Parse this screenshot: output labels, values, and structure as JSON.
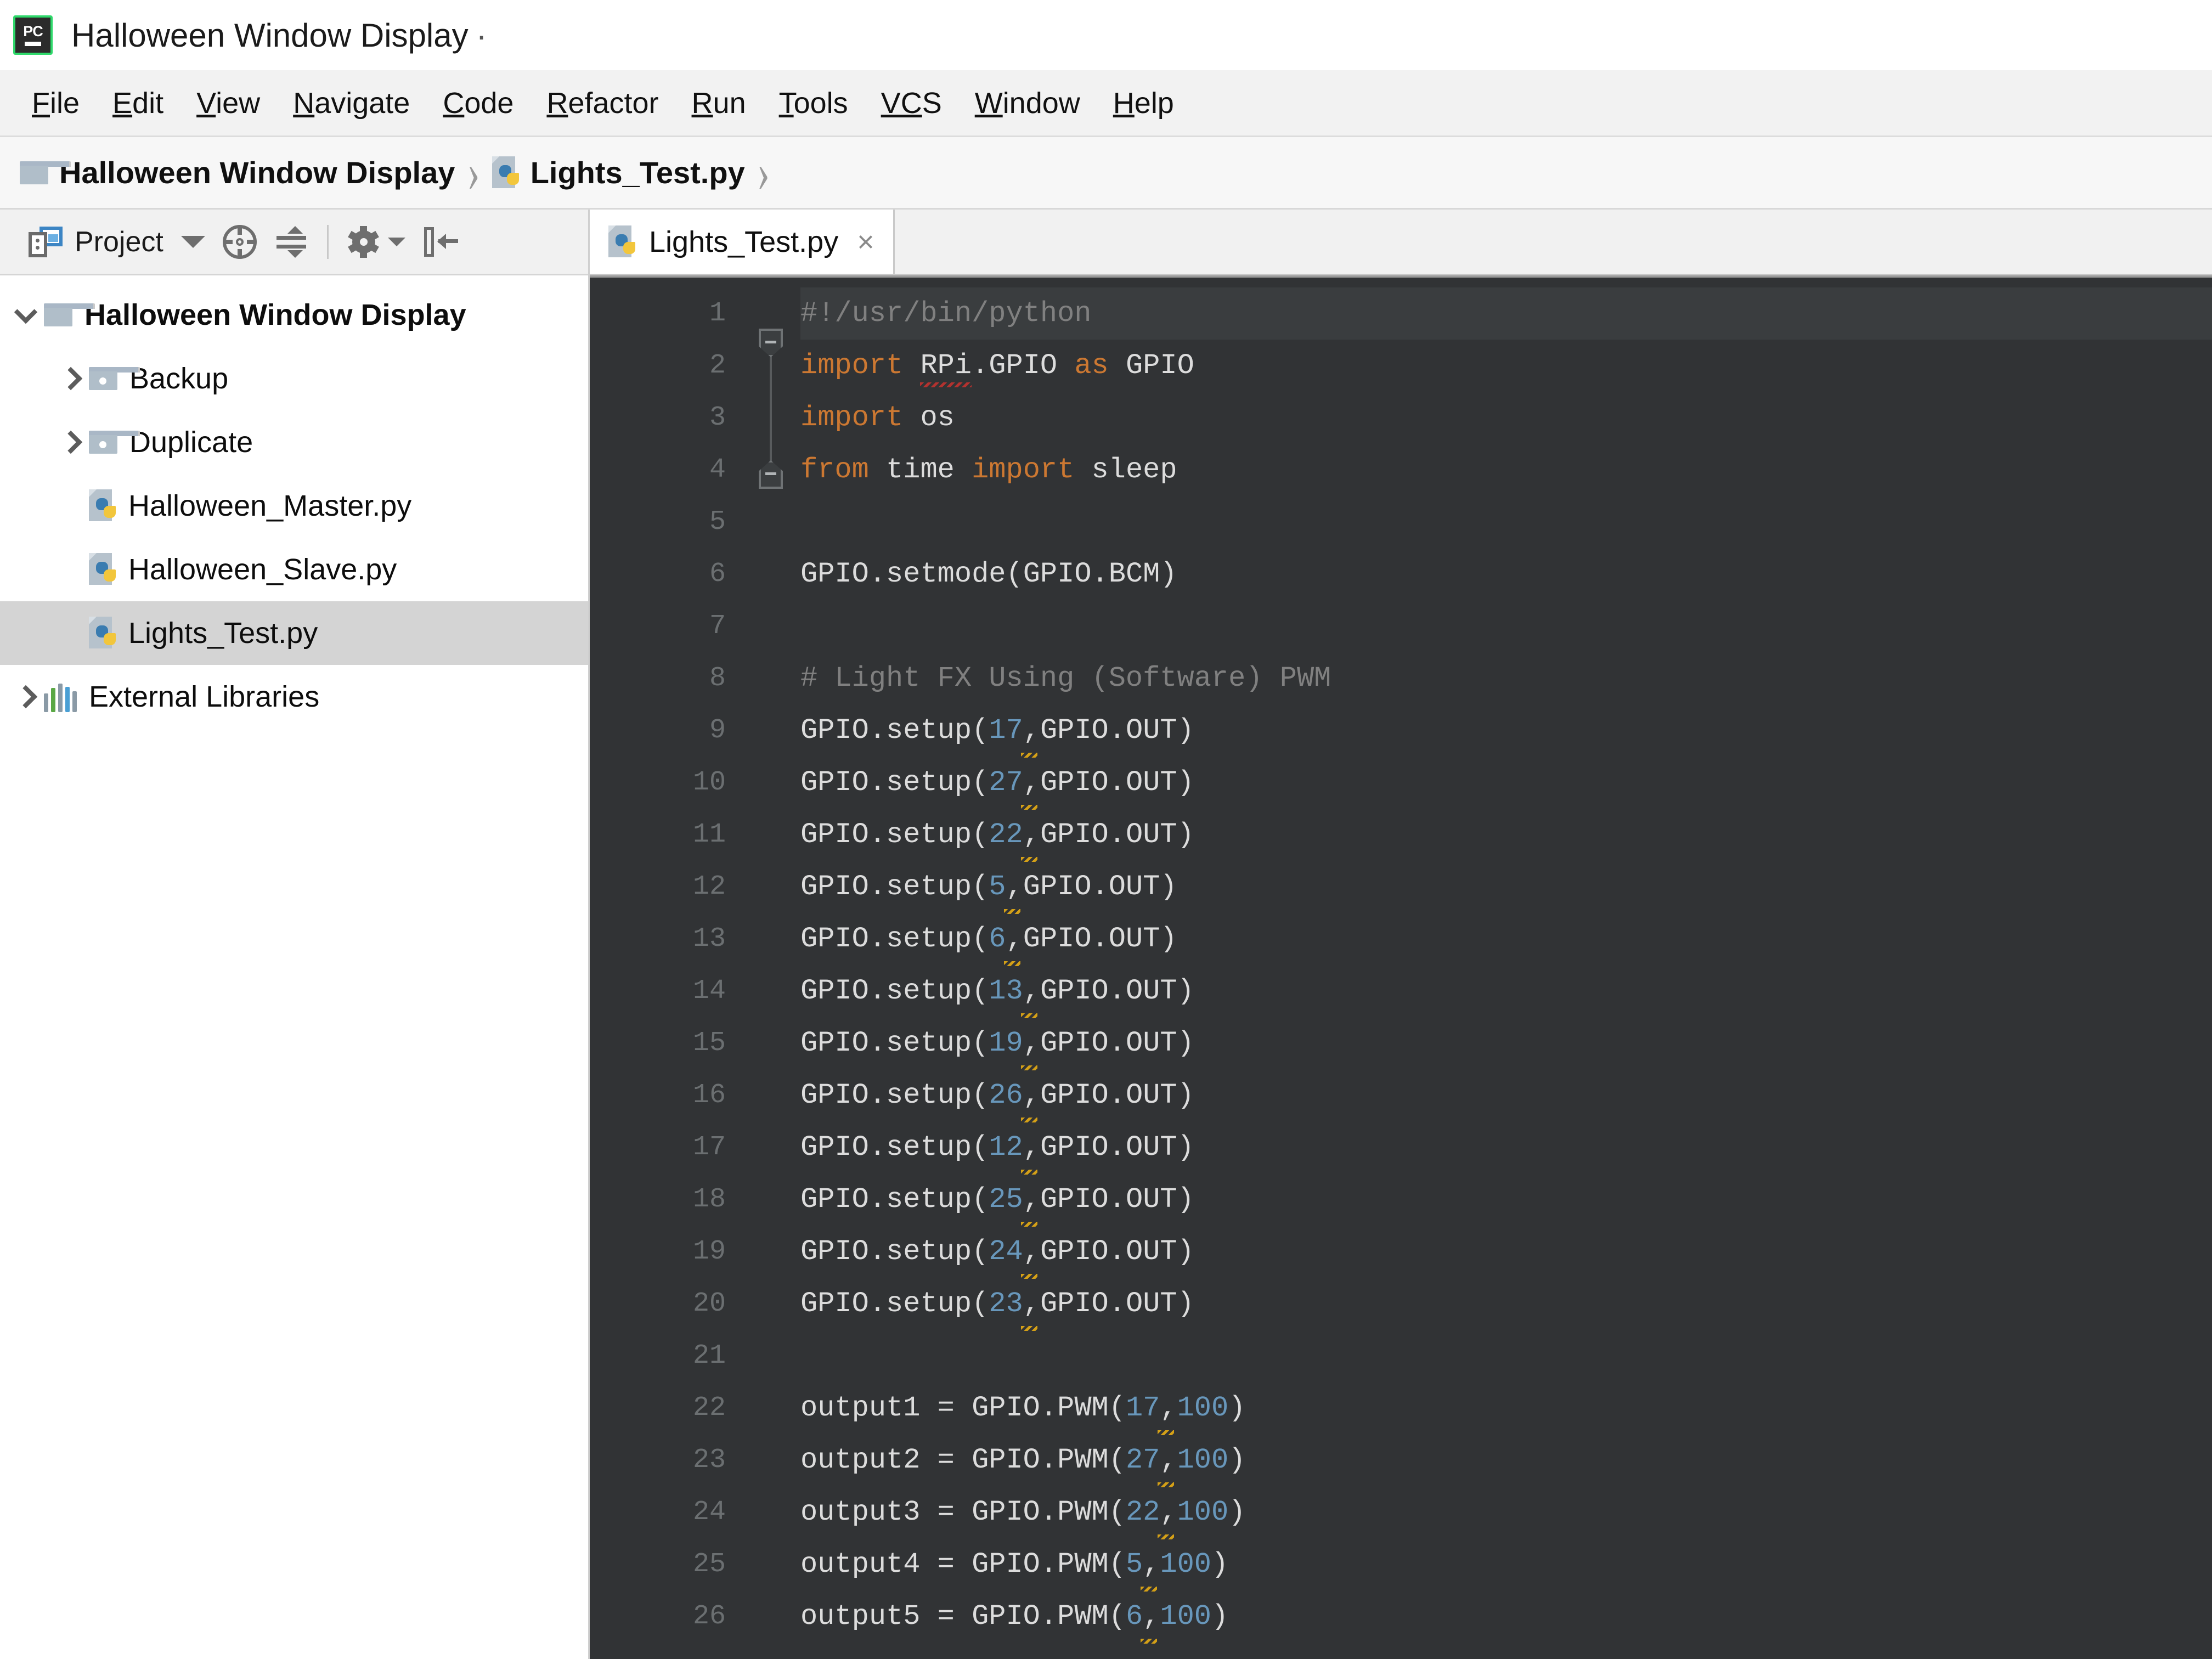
{
  "window": {
    "logo_text": "PC",
    "title": "Halloween Window Display",
    "title_suffix": "·"
  },
  "menubar": {
    "items": [
      {
        "label": "File",
        "mnemonic": "F",
        "rest": "ile"
      },
      {
        "label": "Edit",
        "mnemonic": "E",
        "rest": "dit"
      },
      {
        "label": "View",
        "mnemonic": "V",
        "rest": "iew"
      },
      {
        "label": "Navigate",
        "mnemonic": "N",
        "rest": "avigate"
      },
      {
        "label": "Code",
        "mnemonic": "C",
        "rest": "ode"
      },
      {
        "label": "Refactor",
        "mnemonic": "R",
        "rest": "efactor"
      },
      {
        "label": "Run",
        "mnemonic": "R",
        "rest": "un"
      },
      {
        "label": "Tools",
        "mnemonic": "T",
        "rest": "ools"
      },
      {
        "label": "VCS",
        "mnemonic": "VC",
        "rest": "S"
      },
      {
        "label": "Window",
        "mnemonic": "W",
        "rest": "indow"
      },
      {
        "label": "Help",
        "mnemonic": "H",
        "rest": "elp"
      }
    ]
  },
  "breadcrumb": {
    "project": "Halloween Window Display",
    "file": "Lights_Test.py",
    "separator": "›"
  },
  "panel_toolbar": {
    "title": "Project",
    "icons": [
      "project-icon",
      "chevron-down-icon",
      "locate-icon",
      "collapse-all-icon",
      "gear-icon",
      "hide-panel-icon"
    ]
  },
  "project_tree": {
    "items": [
      {
        "label": "Halloween Window Display",
        "type": "folder-root",
        "expanded": true,
        "depth": 0,
        "bold": true,
        "selected": false
      },
      {
        "label": "Backup",
        "type": "folder",
        "expanded": false,
        "depth": 1,
        "bold": false,
        "selected": false
      },
      {
        "label": "Duplicate",
        "type": "folder",
        "expanded": false,
        "depth": 1,
        "bold": false,
        "selected": false
      },
      {
        "label": "Halloween_Master.py",
        "type": "python",
        "expanded": null,
        "depth": 1,
        "bold": false,
        "selected": false
      },
      {
        "label": "Halloween_Slave.py",
        "type": "python",
        "expanded": null,
        "depth": 1,
        "bold": false,
        "selected": false
      },
      {
        "label": "Lights_Test.py",
        "type": "python",
        "expanded": null,
        "depth": 1,
        "bold": false,
        "selected": true
      },
      {
        "label": "External Libraries",
        "type": "library",
        "expanded": false,
        "depth": 0,
        "bold": false,
        "selected": false
      }
    ]
  },
  "editor": {
    "tab": {
      "label": "Lights_Test.py",
      "close": "×"
    },
    "lines": [
      {
        "n": 1,
        "text": "#!/usr/bin/python"
      },
      {
        "n": 2,
        "text": "import RPi.GPIO as GPIO"
      },
      {
        "n": 3,
        "text": "import os"
      },
      {
        "n": 4,
        "text": "from time import sleep"
      },
      {
        "n": 5,
        "text": ""
      },
      {
        "n": 6,
        "text": "GPIO.setmode(GPIO.BCM)"
      },
      {
        "n": 7,
        "text": ""
      },
      {
        "n": 8,
        "text": "# Light FX Using (Software) PWM"
      },
      {
        "n": 9,
        "text": "GPIO.setup(17,GPIO.OUT)"
      },
      {
        "n": 10,
        "text": "GPIO.setup(27,GPIO.OUT)"
      },
      {
        "n": 11,
        "text": "GPIO.setup(22,GPIO.OUT)"
      },
      {
        "n": 12,
        "text": "GPIO.setup(5,GPIO.OUT)"
      },
      {
        "n": 13,
        "text": "GPIO.setup(6,GPIO.OUT)"
      },
      {
        "n": 14,
        "text": "GPIO.setup(13,GPIO.OUT)"
      },
      {
        "n": 15,
        "text": "GPIO.setup(19,GPIO.OUT)"
      },
      {
        "n": 16,
        "text": "GPIO.setup(26,GPIO.OUT)"
      },
      {
        "n": 17,
        "text": "GPIO.setup(12,GPIO.OUT)"
      },
      {
        "n": 18,
        "text": "GPIO.setup(25,GPIO.OUT)"
      },
      {
        "n": 19,
        "text": "GPIO.setup(24,GPIO.OUT)"
      },
      {
        "n": 20,
        "text": "GPIO.setup(23,GPIO.OUT)"
      },
      {
        "n": 21,
        "text": ""
      },
      {
        "n": 22,
        "text": "output1 = GPIO.PWM(17,100)"
      },
      {
        "n": 23,
        "text": "output2 = GPIO.PWM(27,100)"
      },
      {
        "n": 24,
        "text": "output3 = GPIO.PWM(22,100)"
      },
      {
        "n": 25,
        "text": "output4 = GPIO.PWM(5,100)"
      },
      {
        "n": 26,
        "text": "output5 = GPIO.PWM(6,100)"
      }
    ]
  },
  "colors": {
    "editor_bg": "#313335",
    "keyword": "#cc7832",
    "comment": "#808080",
    "number": "#6897bb",
    "text": "#d8d8d8",
    "line_number": "#6b6f71",
    "selection": "#d4d4d4",
    "accent_green": "#2fd96b"
  }
}
